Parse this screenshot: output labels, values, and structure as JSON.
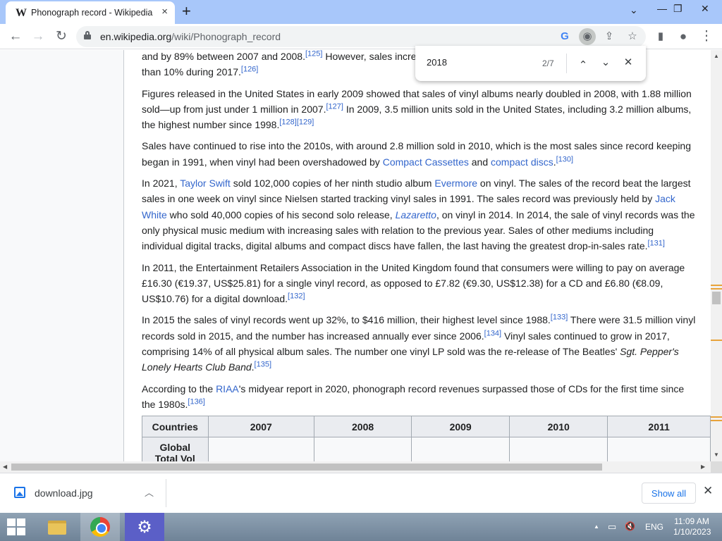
{
  "browser": {
    "tab": {
      "favicon": "W",
      "title": "Phonograph record - Wikipedia",
      "close": "×"
    },
    "new_tab": "+",
    "window_controls": {
      "chevron": "⌄",
      "minimize": "—",
      "restore": "❐",
      "close": "✕"
    },
    "nav": {
      "back": "←",
      "forward": "→",
      "reload": "↻"
    },
    "url": {
      "domain": "en.wikipedia.org",
      "path": "/wiki/Phonograph_record"
    },
    "omni_icons": {
      "google": "G",
      "lens": "◉",
      "share": "⇪",
      "bookmark": "☆",
      "sidepanel": "▮",
      "profile": "●",
      "menu": "⋮"
    }
  },
  "find_bar": {
    "query": "2018",
    "count": "2/7",
    "prev": "⌃",
    "next": "⌄",
    "close": "✕"
  },
  "article": {
    "p1": {
      "t1": "and by 89% between 2007 and 2008.",
      "ref1": "[125]",
      "t2": " However, sales increased by ",
      "t3": " than 10% during 2017.",
      "ref2": "[126]"
    },
    "p2": {
      "t1": "Figures released in the United States in early 2009 showed that sales of vinyl albums nearly doubled in 2008, with 1.88 million sold—up from just under 1 million in 2007.",
      "ref1": "[127]",
      "t2": " In 2009, 3.5 million units sold in the United States, including 3.2 million albums, the highest number since 1998.",
      "ref2": "[128][129]"
    },
    "p3": {
      "t1": "Sales have continued to rise into the 2010s, with around 2.8 million sold in 2010, which is the most sales since record keeping began in 1991, when vinyl had been overshadowed by ",
      "link1": "Compact Cassettes",
      "t2": " and ",
      "link2": "compact discs",
      "t3": ".",
      "ref1": "[130]"
    },
    "p4": {
      "t1": "In 2021, ",
      "link1": "Taylor Swift",
      "t2": " sold 102,000 copies of her ninth studio album ",
      "link2": "Evermore",
      "t3": " on vinyl. The sales of the record beat the largest sales in one week on vinyl since Nielsen started tracking vinyl sales in 1991. The sales record was previously held by ",
      "link3": "Jack White",
      "t4": " who sold 40,000 copies of his second solo release, ",
      "link4": "Lazaretto",
      "t5": ", on vinyl in 2014. In 2014, the sale of vinyl records was the only physical music medium with increasing sales with relation to the previous year. Sales of other mediums including individual digital tracks, digital albums and compact discs have fallen, the last having the greatest drop-in-sales rate.",
      "ref1": "[131]"
    },
    "p5": {
      "t1": "In 2011, the Entertainment Retailers Association in the United Kingdom found that consumers were willing to pay on average £16.30 (€19.37, US$25.81) for a single vinyl record, as opposed to £7.82 (€9.30, US$12.38) for a CD and £6.80 (€8.09, US$10.76) for a digital download.",
      "ref1": "[132]"
    },
    "p6": {
      "t1": "In 2015 the sales of vinyl records went up 32%, to $416 million, their highest level since 1988.",
      "ref1": "[133]",
      "t2": " There were 31.5 million vinyl records sold in 2015, and the number has increased annually ever since 2006.",
      "ref2": "[134]",
      "t3": " Vinyl sales continued to grow in 2017, comprising 14% of all physical album sales. The number one vinyl LP sold was the re-release of The Beatles' ",
      "italic1": "Sgt. Pepper's Lonely Hearts Club Band",
      "t4": ".",
      "ref3": "[135]"
    },
    "p7": {
      "t1": "According to the ",
      "link1": "RIAA",
      "t2": "'s midyear report in 2020, phonograph record revenues surpassed those of CDs for the first time since the 1980s.",
      "ref1": "[136]"
    },
    "table": {
      "headers": [
        "Countries",
        "2007",
        "2008",
        "2009",
        "2010",
        "2011"
      ],
      "row1_label": "Global",
      "row1_label_cont": "Total Vol"
    }
  },
  "downloads": {
    "file": "download.jpg",
    "chevron": "︿",
    "show_all": "Show all",
    "close": "✕"
  },
  "taskbar": {
    "tray": {
      "caret": "▲",
      "network": "▭",
      "volume": "🔇",
      "lang": "ENG"
    },
    "clock": {
      "time": "11:09 AM",
      "date": "1/10/2023"
    }
  }
}
